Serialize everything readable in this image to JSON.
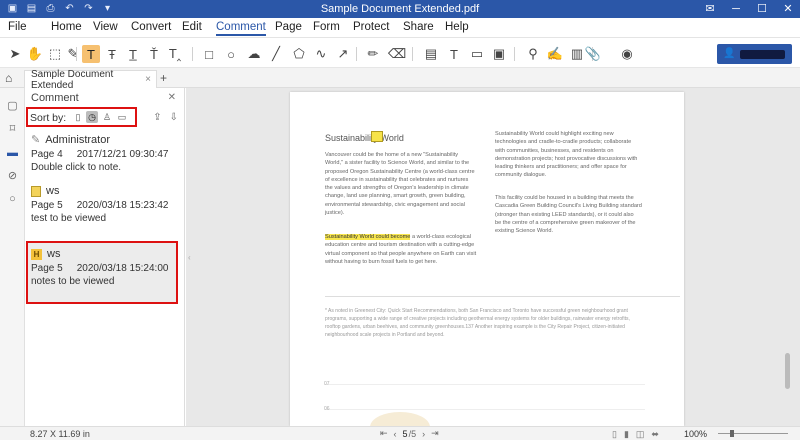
{
  "window": {
    "title": "Sample Document Extended.pdf"
  },
  "menu": {
    "file": "File",
    "items": [
      "Home",
      "View",
      "Convert",
      "Edit",
      "Comment",
      "Page",
      "Form",
      "Protect",
      "Share",
      "Help"
    ],
    "active": "Comment"
  },
  "tab": {
    "name": "Sample Document Extended"
  },
  "panel": {
    "title": "Comment",
    "sort_label": "Sort by:"
  },
  "comments": [
    {
      "author": "Administrator",
      "page": "Page 4",
      "date": "2017/12/21 09:30:47",
      "text": "Double click to note.",
      "icon": "pencil-icon"
    },
    {
      "author": "ws",
      "page": "Page 5",
      "date": "2020/03/18 15:23:42",
      "text": "test to be viewed",
      "icon": "sticky-note-icon"
    },
    {
      "author": "ws",
      "page": "Page 5",
      "date": "2020/03/18 15:24:00",
      "text": "notes to be viewed",
      "icon": "highlight-icon"
    }
  ],
  "doc": {
    "heading": "Sustainability World",
    "left_col": [
      "Vancouver could be the home of a new \"Sustainability",
      "World,\" a sister facility to Science World, and similar to the",
      "proposed Oregon Sustainability Centre (a world-class centre",
      "of excellence in sustainability that celebrates and nurtures",
      "the values and strengths of Oregon's leadership in climate",
      "change, land use planning, smart growth, green building,",
      "environmental stewardship, civic engagement and social",
      "justice)."
    ],
    "highlight": "Sustainability World could become",
    "left_col2_first_rest": " a world-class ecological",
    "left_col2": [
      "education centre and tourism destination with a cutting-edge",
      "virtual component so that people anywhere on Earth can visit",
      "without having to burn fossil fuels to get here."
    ],
    "right_col": [
      "Sustainability World could highlight exciting new",
      "technologies and cradle-to-cradle products; collaborate",
      "with communities, businesses, and residents on",
      "demonstration projects; host provocative discussions with",
      "leading thinkers and practitioners; and offer space for",
      "community dialogue."
    ],
    "right_col2": [
      "This facility could be housed in a building that meets the",
      "Cascadia Green Building Council's Living Building standard",
      "(stronger than existing LEED standards), or it could also",
      "be the centre of a comprehensive green makeover of the",
      "existing Science World."
    ],
    "footnote": [
      "* As noted in Greenest City: Quick Start Recommendations, both San Francisco and Toronto have successful green neighbourhood grant",
      "programs, supporting a wide range of creative projects including geothermal energy systems for older buildings, rainwater energy retrofits,",
      "rooftop gardens, urban beehives, and community greenhouses.137 Another inspiring example is the City Repair Project, citizen-initiated",
      "neighbourhood scale projects in Portland and beyond."
    ],
    "axis_labels": [
      "07",
      "06"
    ]
  },
  "status": {
    "dimensions": "8.27 X 11.69 in",
    "page_current": "5",
    "page_total": "/5",
    "zoom": "100%"
  },
  "colors": {
    "titlebar": "#2b57a8",
    "highlight": "#f8e64e",
    "annotation_box": "#dd1111"
  }
}
